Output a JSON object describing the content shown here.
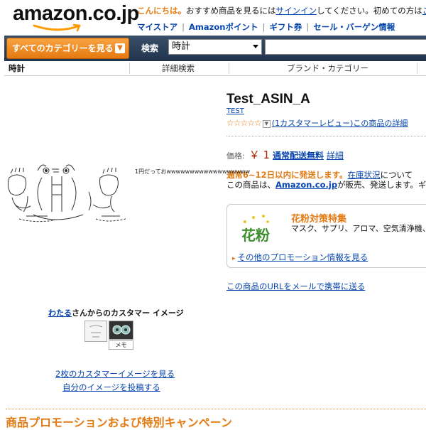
{
  "header": {
    "logo_text": "amazon.co.jp",
    "greeting_hi": "こんにちは。",
    "greeting_mid": "おすすめ商品を見るには",
    "greeting_link": "サインイン",
    "greeting_tail": "してください。初めての方は",
    "greeting_link2": "こち",
    "nav": [
      "マイストア",
      "Amazonポイント",
      "ギフト券",
      "セール・バーゲン情報"
    ]
  },
  "search": {
    "all_categories": "すべてのカテゴリーを見る",
    "label": "検索",
    "selected_category": "時計",
    "query": ""
  },
  "subnav": {
    "current": "時計",
    "items": [
      "詳細検索",
      "ブランド・カテゴリー"
    ]
  },
  "product": {
    "title": "Test_ASIN_A",
    "brand": "TEST",
    "stars": "☆☆☆☆☆",
    "review_link": "(1カスタマーレビュー)",
    "detail_link": "この商品の詳細",
    "price_label": "価格:",
    "price": "￥ 1",
    "free_shipping": "通常配送無料",
    "details_link": "詳細",
    "ship_time": "通常6~12日以内に発送します。",
    "stock_link": "在庫状況",
    "ship_tail": "について",
    "seller_prefix": "この商品は、",
    "seller": "Amazon.co.jp",
    "seller_tail": "が販売、発送します。ギフト"
  },
  "promo": {
    "icon_text": "花粉",
    "title": "花粉対策特集",
    "desc": "マスク、サプリ、アロマ、空気清浄機、ト",
    "link": "その他のプロモーション情報を見る"
  },
  "mail_link": "この商品のURLをメールで携帯に送る",
  "aa": {
    "caption": "1円だっておwwwwwwwwwwwwwwwwww"
  },
  "customer_images": {
    "user": "わたる",
    "title_tail": "さんからのカスタマー イメージ",
    "memo": "メモ",
    "more_link": "2枚のカスタマーイメージを見る",
    "post_link": "自分のイメージを投稿する"
  },
  "campaign_title": "商品プロモーションおよび特別キャンペーン",
  "colors": {
    "accent": "#e47911",
    "link": "#0645ad",
    "navbar": "#22344d"
  }
}
